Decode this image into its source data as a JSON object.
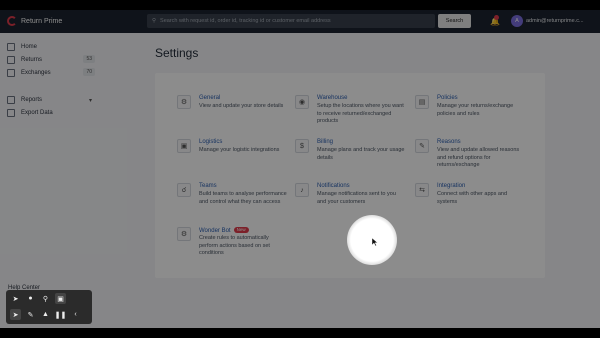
{
  "header": {
    "brand": "Return Prime",
    "search_placeholder": "Search with request id, order id, tracking id or customer email address",
    "search_button": "Search",
    "avatar_initial": "A",
    "user_email": "admin@returnprime.c..."
  },
  "sidebar": {
    "items": [
      {
        "label": "Home"
      },
      {
        "label": "Returns",
        "count": "53"
      },
      {
        "label": "Exchanges",
        "count": "70"
      },
      {
        "label": "Reports"
      },
      {
        "label": "Export Data"
      }
    ],
    "help": "Help Center"
  },
  "page": {
    "title": "Settings"
  },
  "settings": [
    {
      "title": "General",
      "desc": "View and update your store details"
    },
    {
      "title": "Warehouse",
      "desc": "Setup the locations where you want to receive returned/exchanged products"
    },
    {
      "title": "Policies",
      "desc": "Manage your returns/exchange policies and rules"
    },
    {
      "title": "Logistics",
      "desc": "Manage your logistic integrations"
    },
    {
      "title": "Billing",
      "desc": "Manage plans and track your usage details"
    },
    {
      "title": "Reasons",
      "desc": "View and update allowed reasons and refund options for returns/exchange"
    },
    {
      "title": "Teams",
      "desc": "Build teams to analyse performance and control what they can access"
    },
    {
      "title": "Notifications",
      "desc": "Manage notifications sent to you and your customers"
    },
    {
      "title": "Integration",
      "desc": "Connect with other apps and systems"
    },
    {
      "title": "Wonder Bot",
      "badge": "New",
      "desc": "Create rules to automatically perform actions based on set conditions"
    }
  ]
}
